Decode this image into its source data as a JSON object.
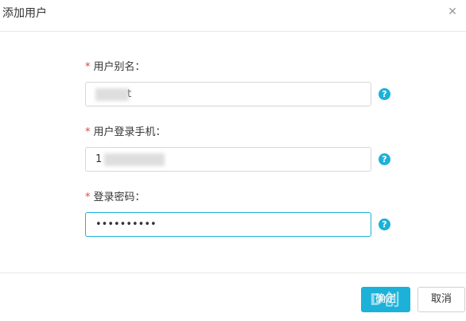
{
  "dialog": {
    "title": "添加用户",
    "close_glyph": "✕"
  },
  "form": {
    "required_mark": "*",
    "help_glyph": "?",
    "fields": [
      {
        "label": "用户别名：",
        "value": "t"
      },
      {
        "label": "用户登录手机：",
        "value": "1"
      },
      {
        "label": "登录密码：",
        "value": "••••••••••"
      }
    ]
  },
  "footer": {
    "confirm_label": "确定",
    "cancel_label": "取消"
  },
  "watermark": {
    "text": "D创"
  },
  "colors": {
    "accent": "#1cb1d8",
    "required": "#e64545"
  },
  "icons": [
    "close-icon",
    "help-icon"
  ]
}
